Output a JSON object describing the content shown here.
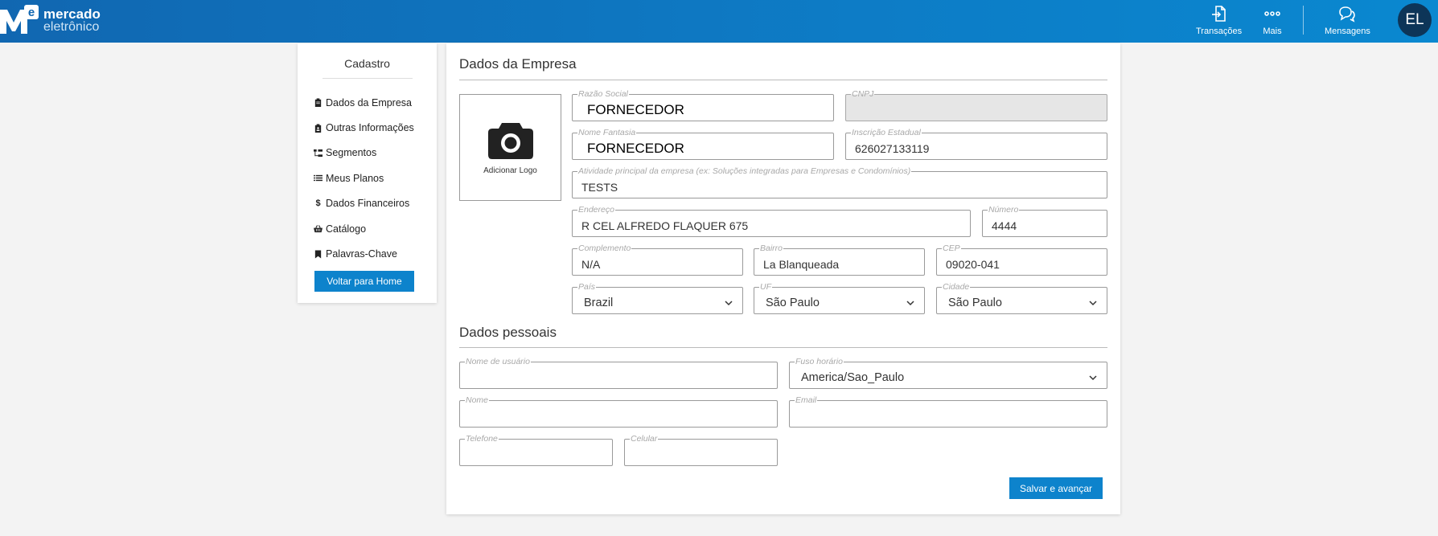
{
  "header": {
    "brand_line1": "mercado",
    "brand_line2": "eletrônico",
    "nav": [
      {
        "label": "Transações",
        "icon": "transactions-icon"
      },
      {
        "label": "Mais",
        "icon": "more-dots-icon"
      },
      {
        "label": "Mensagens",
        "icon": "messages-icon"
      }
    ],
    "avatar_initials": "EL"
  },
  "sidebar": {
    "title": "Cadastro",
    "items": [
      {
        "label": "Dados da Empresa",
        "icon": "clipboard-icon"
      },
      {
        "label": "Outras Informações",
        "icon": "clipboard-user-icon"
      },
      {
        "label": "Segmentos",
        "icon": "segments-tree-icon"
      },
      {
        "label": "Meus Planos",
        "icon": "list-icon"
      },
      {
        "label": "Dados Financeiros",
        "icon": "dollar-icon"
      },
      {
        "label": "Catálogo",
        "icon": "basket-icon"
      },
      {
        "label": "Palavras-Chave",
        "icon": "bookmark-icon"
      }
    ],
    "home_button": "Voltar para Home"
  },
  "company": {
    "title": "Dados da Empresa",
    "add_logo": "Adicionar Logo",
    "razao_social": {
      "label": "Razão Social",
      "value": "FORNECEDOR"
    },
    "cnpj": {
      "label": "CNPJ",
      "value": ""
    },
    "nome_fantasia": {
      "label": "Nome Fantasia",
      "value": "FORNECEDOR"
    },
    "inscricao_estadual": {
      "label": "Inscrição Estadual",
      "value": "626027133119"
    },
    "atividade": {
      "label": "Atividade principal da empresa (ex: Soluções integradas para Empresas e Condomínios)",
      "value": "TESTS"
    },
    "endereco": {
      "label": "Endereço",
      "value": "R CEL ALFREDO FLAQUER 675"
    },
    "numero": {
      "label": "Número",
      "value": "4444"
    },
    "complemento": {
      "label": "Complemento",
      "value": "N/A"
    },
    "bairro": {
      "label": "Bairro",
      "value": "La Blanqueada"
    },
    "cep": {
      "label": "CEP",
      "value": "09020-041"
    },
    "pais": {
      "label": "País",
      "value": "Brazil"
    },
    "uf": {
      "label": "UF",
      "value": "São Paulo"
    },
    "cidade": {
      "label": "Cidade",
      "value": "São Paulo"
    }
  },
  "personal": {
    "title": "Dados pessoais",
    "nome_usuario": {
      "label": "Nome de usuário",
      "value": ""
    },
    "fuso_horario": {
      "label": "Fuso horário",
      "value": "America/Sao_Paulo"
    },
    "nome": {
      "label": "Nome",
      "value": ""
    },
    "email": {
      "label": "Email",
      "value": ""
    },
    "telefone": {
      "label": "Telefone",
      "value": ""
    },
    "celular": {
      "label": "Celular",
      "value": ""
    }
  },
  "save_button": "Salvar e avançar",
  "colors": {
    "header": "#1167b1",
    "button": "#0d83cc",
    "avatar": "#0d3558"
  }
}
